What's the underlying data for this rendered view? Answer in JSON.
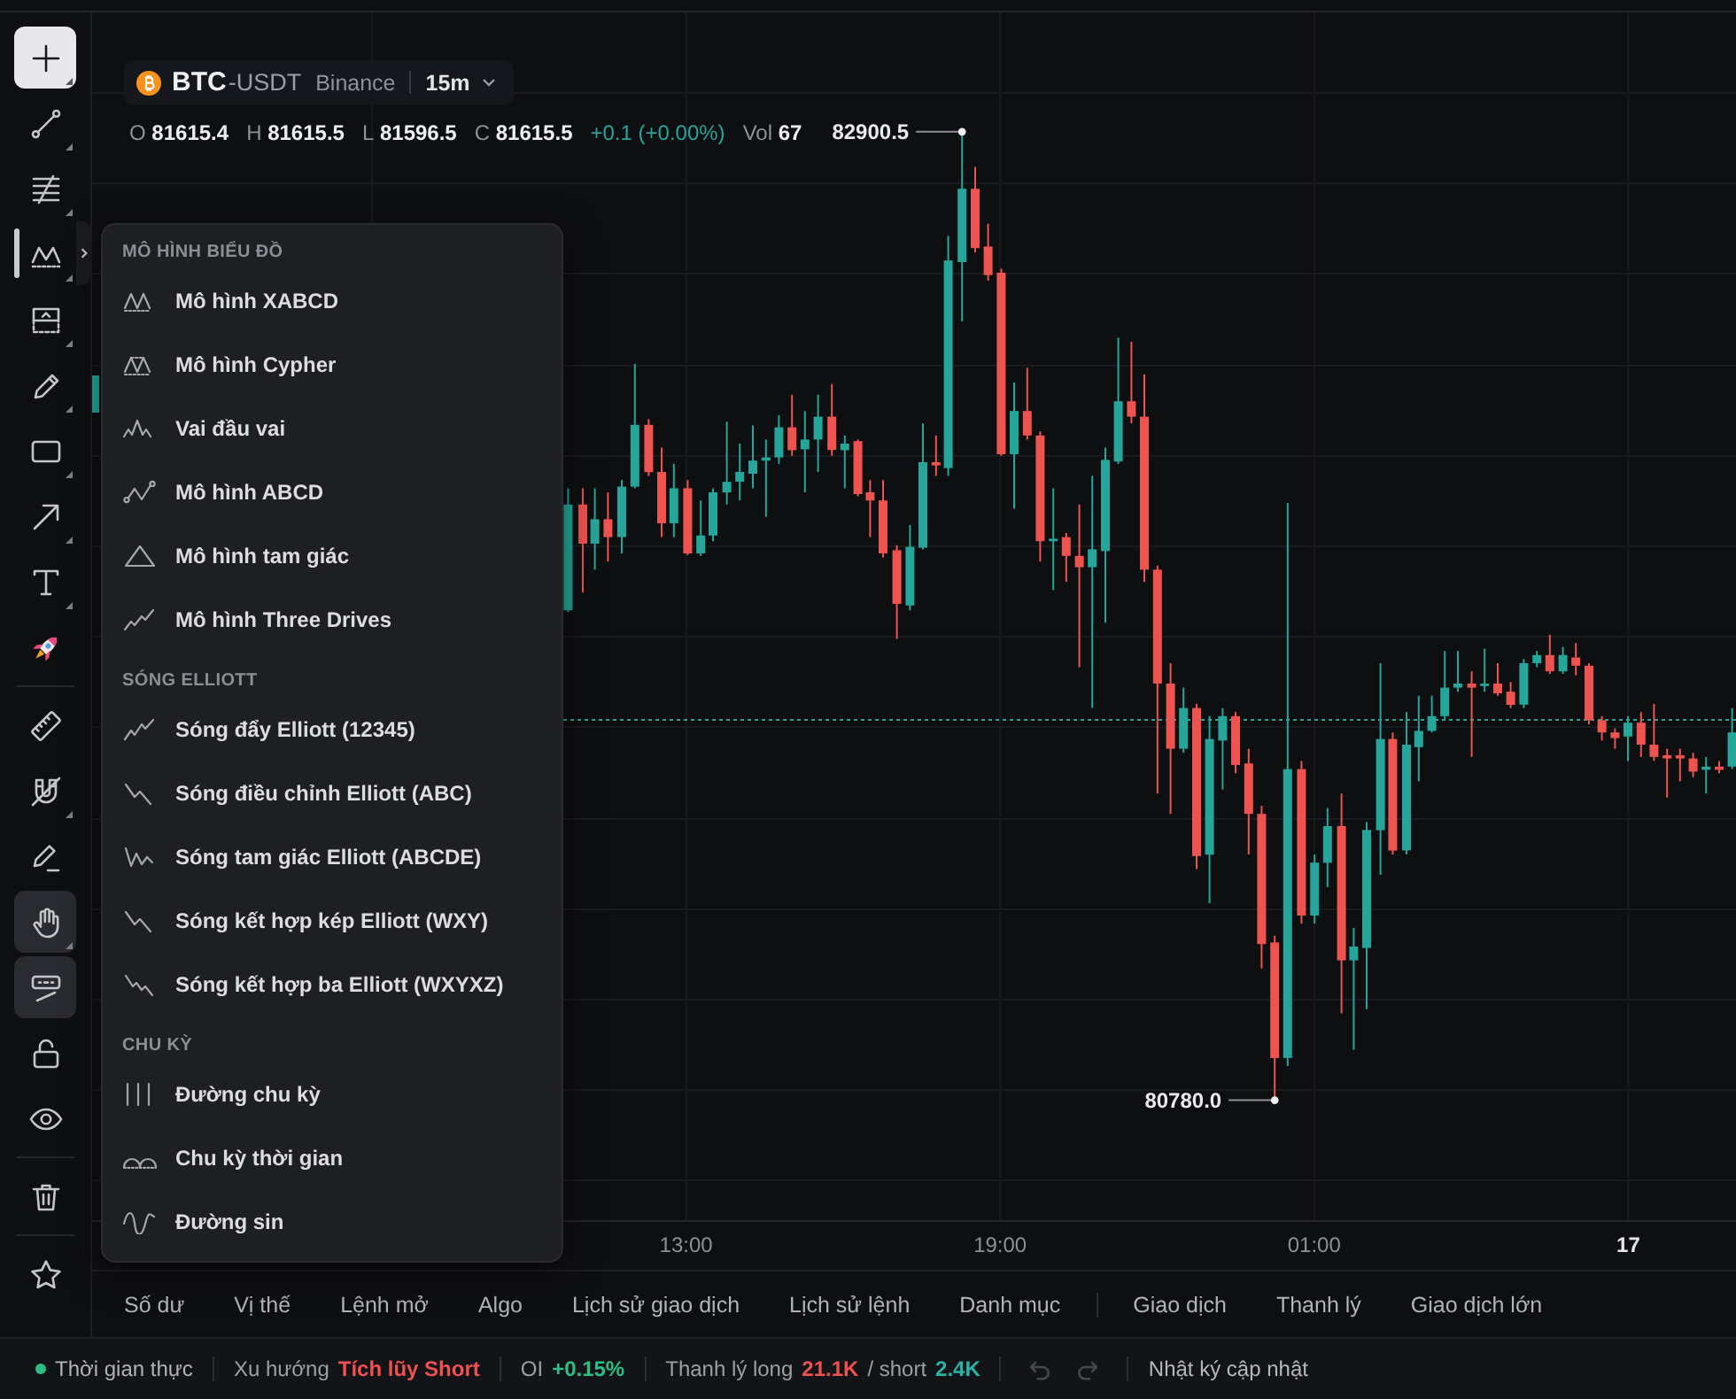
{
  "toolbar": {
    "groups": [
      [
        {
          "selected": true,
          "expanded": false,
          "on": false,
          "has_options": true
        },
        {
          "selected": false,
          "expanded": false,
          "on": false,
          "has_options": true
        },
        {
          "selected": false,
          "expanded": false,
          "on": false,
          "has_options": true
        },
        {
          "selected": false,
          "expanded": true,
          "on": false,
          "has_options": true
        },
        {
          "selected": false,
          "expanded": false,
          "on": false,
          "has_options": true
        },
        {
          "selected": false,
          "expanded": false,
          "on": false,
          "has_options": true
        },
        {
          "selected": false,
          "expanded": false,
          "on": false,
          "has_options": true
        },
        {
          "selected": false,
          "expanded": false,
          "on": false,
          "has_options": true
        },
        {
          "selected": false,
          "expanded": false,
          "on": false,
          "has_options": true
        },
        {
          "selected": false,
          "expanded": false,
          "on": false,
          "has_options": false
        }
      ],
      [
        {
          "selected": false,
          "expanded": false,
          "on": false,
          "has_options": false
        },
        {
          "selected": false,
          "expanded": false,
          "on": false,
          "has_options": true
        },
        {
          "selected": false,
          "expanded": false,
          "on": false,
          "has_options": false
        },
        {
          "selected": false,
          "expanded": false,
          "on": true,
          "has_options": true
        },
        {
          "selected": false,
          "expanded": false,
          "on": true,
          "has_options": false
        },
        {
          "selected": false,
          "expanded": false,
          "on": false,
          "has_options": false
        },
        {
          "selected": false,
          "expanded": false,
          "on": false,
          "has_options": false
        }
      ],
      [
        {
          "selected": false,
          "expanded": false,
          "on": false,
          "has_options": false
        }
      ],
      [
        {
          "selected": false,
          "expanded": false,
          "on": false,
          "has_options": false
        }
      ]
    ]
  },
  "legend": {
    "base": "BTC",
    "quote": "-USDT",
    "exchange": "Binance",
    "interval": "15m",
    "ohlc": [
      {
        "label": "O",
        "value": "81615.4"
      },
      {
        "label": "H",
        "value": "81615.5"
      },
      {
        "label": "L",
        "value": "81596.5"
      },
      {
        "label": "C",
        "value": "81615.5"
      }
    ],
    "change": "+0.1 (+0.00%)",
    "volume": {
      "label": "Vol",
      "value": "67"
    }
  },
  "chart": {
    "high_label": "82900.5",
    "low_label": "80780.0",
    "time_labels": [
      {
        "text": "13:00",
        "kind": "time"
      },
      {
        "text": "19:00",
        "kind": "time"
      },
      {
        "text": "01:00",
        "kind": "time"
      },
      {
        "text": "17",
        "kind": "day"
      }
    ]
  },
  "drawing_menu": {
    "sections": [
      {
        "title": "MÔ HÌNH BIỂU ĐỒ",
        "items": [
          "Mô hình XABCD",
          "Mô hình Cypher",
          "Vai đầu vai",
          "Mô hình ABCD",
          "Mô hình tam giác",
          "Mô hình Three Drives"
        ]
      },
      {
        "title": "SÓNG ELLIOTT",
        "items": [
          "Sóng đẩy Elliott (12345)",
          "Sóng điều chỉnh Elliott (ABC)",
          "Sóng tam giác Elliott (ABCDE)",
          "Sóng kết hợp kép Elliott (WXY)",
          "Sóng kết hợp ba Elliott (WXYXZ)"
        ]
      },
      {
        "title": "CHU KỲ",
        "items": [
          "Đường chu kỳ",
          "Chu kỳ thời gian",
          "Đường sin"
        ]
      }
    ]
  },
  "bottom_tabs": {
    "groups": [
      [
        {
          "label": "Số dư",
          "selected": false
        },
        {
          "label": "Vị thế",
          "selected": false
        },
        {
          "label": "Lệnh mở",
          "selected": false
        },
        {
          "label": "Algo",
          "selected": false
        },
        {
          "label": "Lịch sử giao dịch",
          "selected": false
        },
        {
          "label": "Lịch sử lệnh",
          "selected": false
        },
        {
          "label": "Danh mục",
          "selected": false
        }
      ],
      [
        {
          "label": "Giao dịch",
          "selected": false
        },
        {
          "label": "Thanh lý",
          "selected": false
        },
        {
          "label": "Giao dịch lớn",
          "selected": false
        }
      ]
    ]
  },
  "status_bar": {
    "live": {
      "label": "Thời gian thực",
      "color": "#2ebd85"
    },
    "metrics": [
      [
        {
          "label": "Xu hướng",
          "value": "Tích lũy Short",
          "color": "#f0504f"
        }
      ],
      [
        {
          "label": "OI",
          "value": "+0.15%",
          "color": "#2ebd85"
        }
      ],
      [
        {
          "label": "Thanh lý long",
          "value": "21.1K",
          "color": "#f0504f"
        },
        {
          "label": "/ short",
          "value": "2.4K",
          "color": "#26b5a5"
        }
      ]
    ],
    "history_buttons": [
      {
        "disabled": true
      },
      {
        "disabled": true
      }
    ],
    "changelog": "Nhật ký cập nhật"
  }
}
